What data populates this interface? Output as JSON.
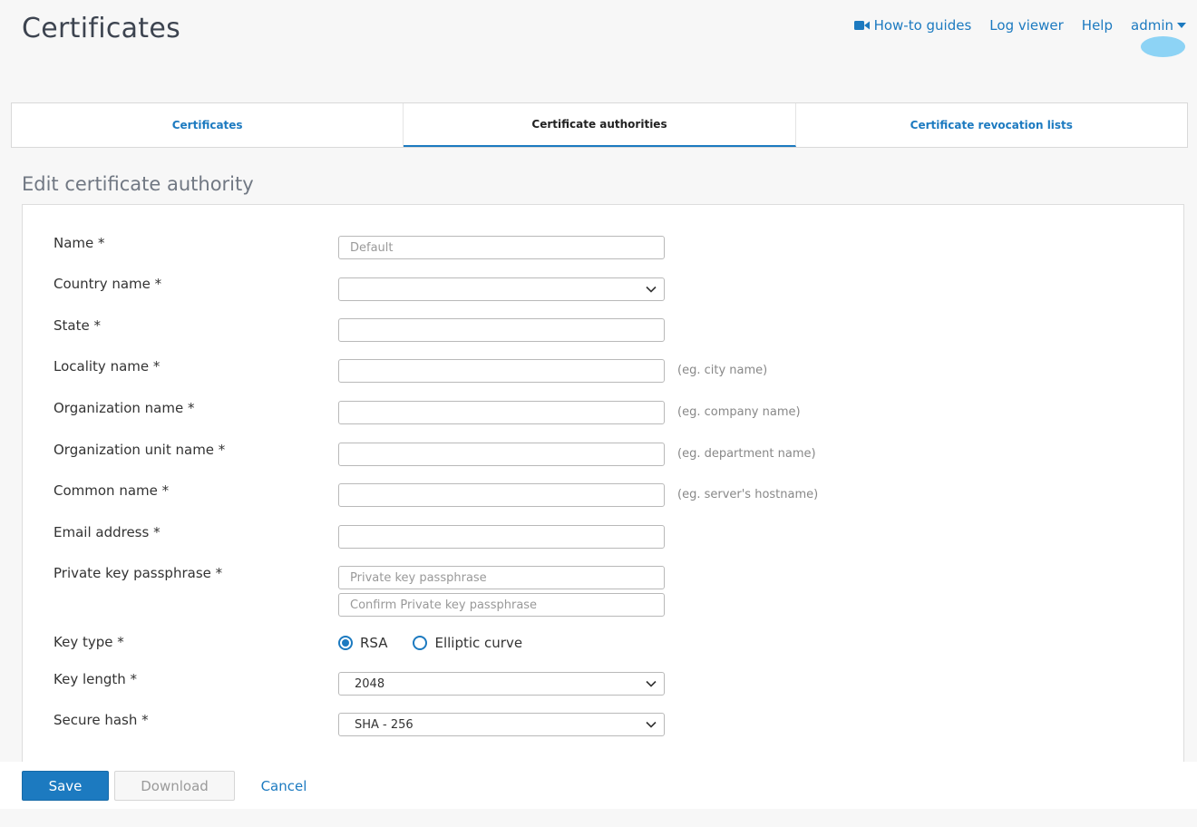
{
  "header": {
    "title": "Certificates",
    "nav": {
      "howto": "How-to guides",
      "logviewer": "Log viewer",
      "help": "Help",
      "user": "admin"
    }
  },
  "tabs": [
    {
      "label": "Certificates",
      "active": false
    },
    {
      "label": "Certificate authorities",
      "active": true
    },
    {
      "label": "Certificate revocation lists",
      "active": false
    }
  ],
  "form": {
    "title": "Edit certificate authority",
    "name": {
      "label": "Name *",
      "value": "Default"
    },
    "country": {
      "label": "Country name *",
      "value": ""
    },
    "state": {
      "label": "State *",
      "value": ""
    },
    "locality": {
      "label": "Locality name *",
      "value": "",
      "hint": "(eg. city name)"
    },
    "organization": {
      "label": "Organization name *",
      "value": "",
      "hint": "(eg. company name)"
    },
    "org_unit": {
      "label": "Organization unit name *",
      "value": "",
      "hint": "(eg. department name)"
    },
    "common_name": {
      "label": "Common name *",
      "value": "",
      "hint": "(eg. server's hostname)"
    },
    "email": {
      "label": "Email address *",
      "value": ""
    },
    "passphrase": {
      "label": "Private key passphrase *",
      "placeholder": "Private key passphrase",
      "confirm_placeholder": "Confirm Private key passphrase"
    },
    "key_type": {
      "label": "Key type *",
      "options": [
        "RSA",
        "Elliptic curve"
      ],
      "selected": "RSA"
    },
    "key_length": {
      "label": "Key length *",
      "value": "2048"
    },
    "secure_hash": {
      "label": "Secure hash *",
      "value": "SHA - 256"
    }
  },
  "footer": {
    "save": "Save",
    "download": "Download",
    "cancel": "Cancel"
  },
  "colors": {
    "accent": "#1c7ac0",
    "background": "#f7f7f7"
  }
}
